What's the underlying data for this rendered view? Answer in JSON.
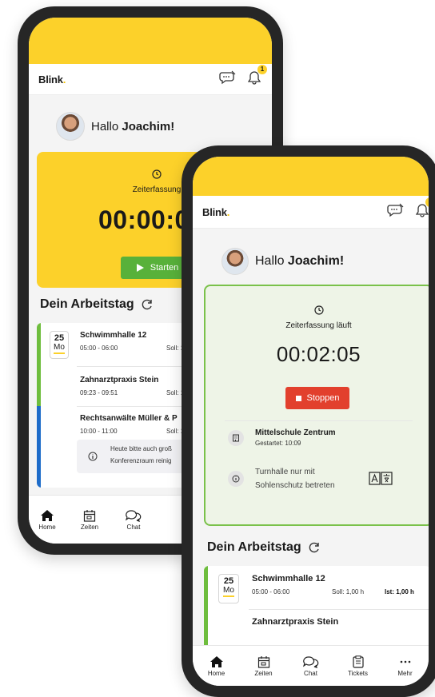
{
  "app": {
    "logo": "Blink",
    "logo_dot": ".",
    "notification_count": "1"
  },
  "greeting": {
    "prefix": "Hallo",
    "name": "Joachim!"
  },
  "back": {
    "time_card": {
      "label": "Zeiterfassung",
      "timer": "00:00:0",
      "start_label": "Starten"
    },
    "section_title": "Dein Arbeitstag",
    "date": {
      "day": "25",
      "weekday": "Mo"
    },
    "entries": [
      {
        "title": "Schwimmhalle 12",
        "time": "05:00 - 06:00",
        "soll": "Soll: 1,0"
      },
      {
        "title": "Zahnarztpraxis Stein",
        "time": "09:23 - 09:51",
        "soll": "Soll: 1,0"
      },
      {
        "title": "Rechtsanwälte Müller & P",
        "time": "10:00 - 11:00",
        "soll": "Soll: 1,0"
      }
    ],
    "notice": {
      "line1": "Heute bitte auch groß",
      "line2": "Konferenzraum reinig"
    },
    "tabs": [
      "Home",
      "Zeiten",
      "Chat"
    ]
  },
  "front": {
    "time_card": {
      "label": "Zeiterfassung läuft",
      "timer": "00:02:05",
      "stop_label": "Stoppen"
    },
    "location": {
      "title": "Mittelschule Zentrum",
      "started": "Gestartet: 10:09"
    },
    "info": {
      "line1": "Turnhalle nur mit",
      "line2": "Sohlenschutz betreten"
    },
    "section_title": "Dein Arbeitstag",
    "date": {
      "day": "25",
      "weekday": "Mo"
    },
    "entries": [
      {
        "title": "Schwimmhalle 12",
        "time": "05:00 - 06:00",
        "soll": "Soll: 1,00 h",
        "ist": "Ist: 1,00 h"
      },
      {
        "title": "Zahnarztpraxis Stein"
      }
    ],
    "tabs": [
      "Home",
      "Zeiten",
      "Chat",
      "Tickets",
      "Mehr"
    ]
  },
  "colors": {
    "brand_yellow": "#fcd12a",
    "start_green": "#58b13a",
    "stop_red": "#e2402d",
    "active_border": "#7ac14a",
    "shift_blue": "#1e6cc9"
  }
}
